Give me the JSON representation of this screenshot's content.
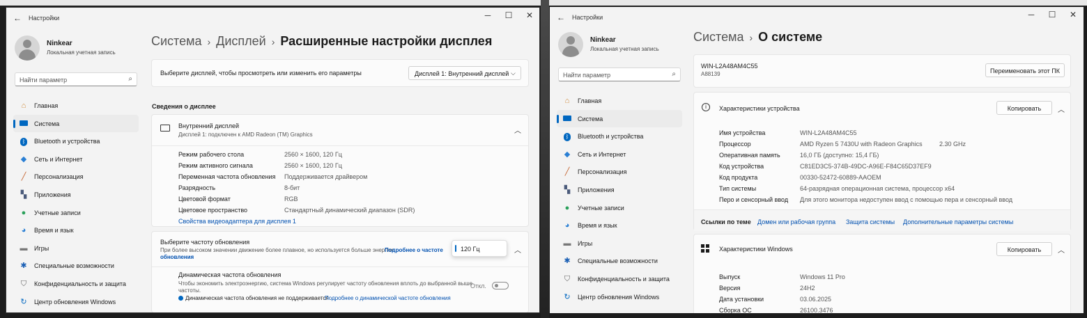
{
  "left": {
    "app_title": "Настройки",
    "profile": {
      "name": "Ninkear",
      "subtitle": "Локальная учетная запись"
    },
    "search_placeholder": "Найти параметр",
    "nav": [
      {
        "label": "Главная",
        "icon": "home-icon"
      },
      {
        "label": "Система",
        "icon": "monitor-icon"
      },
      {
        "label": "Bluetooth и устройства",
        "icon": "bluetooth-icon"
      },
      {
        "label": "Сеть и Интернет",
        "icon": "wifi-icon"
      },
      {
        "label": "Персонализация",
        "icon": "brush-icon"
      },
      {
        "label": "Приложения",
        "icon": "apps-icon"
      },
      {
        "label": "Учетные записи",
        "icon": "user-icon"
      },
      {
        "label": "Время и язык",
        "icon": "globe-icon"
      },
      {
        "label": "Игры",
        "icon": "gamepad-icon"
      },
      {
        "label": "Специальные возможности",
        "icon": "accessibility-icon"
      },
      {
        "label": "Конфиденциальность и защита",
        "icon": "shield-icon"
      },
      {
        "label": "Центр обновления Windows",
        "icon": "update-icon"
      }
    ],
    "breadcrumb": [
      "Система",
      "Дисплей"
    ],
    "page_title": "Расширенные настройки дисплея",
    "select_prompt": "Выберите дисплей, чтобы просмотреть или изменить его параметры",
    "display_select": "Дисплей 1: Внутренний дисплей",
    "section_title": "Сведения о дисплее",
    "display_name": "Внутренний дисплей",
    "display_sub": "Дисплей 1: подключен к AMD Radeon (TM) Graphics",
    "info": [
      {
        "k": "Режим рабочего стола",
        "v": "2560 × 1600, 120 Гц"
      },
      {
        "k": "Режим активного сигнала",
        "v": "2560 × 1600, 120 Гц"
      },
      {
        "k": "Переменная частота обновления",
        "v": "Поддерживается драйвером"
      },
      {
        "k": "Разрядность",
        "v": "8-бит"
      },
      {
        "k": "Цветовой формат",
        "v": "RGB"
      },
      {
        "k": "Цветовое пространство",
        "v": "Стандартный динамический диапазон (SDR)"
      }
    ],
    "adapter_link": "Свойства видеоадаптера для дисплея 1",
    "refresh_title": "Выберите частоту обновления",
    "refresh_desc": "При более высоком значении движение более плавное, но используется больше энергии",
    "refresh_more_a": "Подробнее о частоте",
    "refresh_more_b": "обновления",
    "refresh_value": "120 Гц",
    "dynamic_title": "Динамическая частота обновления",
    "dynamic_desc_a": "Чтобы экономить электроэнергию, система Windows регулирует частоту обновления вплоть до выбранной выше",
    "dynamic_desc_b": "частоты.",
    "dynamic_toggle": "Откл.",
    "dynamic_note": "Динамическая частота обновления не поддерживается",
    "dynamic_more": "Подробнее о динамической частоте обновления"
  },
  "right": {
    "app_title": "Настройки",
    "profile": {
      "name": "Ninkear",
      "subtitle": "Локальная учетная запись"
    },
    "search_placeholder": "Найти параметр",
    "breadcrumb": [
      "Система"
    ],
    "page_title": "О системе",
    "pc_name": "WIN-L2A48AM4C55",
    "pc_model": "A88139",
    "rename_button": "Переименовать этот ПК",
    "device_section": "Характеристики устройства",
    "copy_button": "Копировать",
    "device_specs": [
      {
        "k": "Имя устройства",
        "v": "WIN-L2A48AM4C55"
      },
      {
        "k": "Процессор",
        "v": "AMD Ryzen 5 7430U with Radeon Graphics",
        "extra": "2.30 GHz"
      },
      {
        "k": "Оперативная память",
        "v": "16,0 ГБ (доступно: 15,4 ГБ)"
      },
      {
        "k": "Код устройства",
        "v": "C81ED3C5-374B-49DC-A96E-F84C65D37EF9"
      },
      {
        "k": "Код продукта",
        "v": "00330-52472-60889-AAOEM"
      },
      {
        "k": "Тип системы",
        "v": "64-разрядная операционная система, процессор x64"
      },
      {
        "k": "Перо и сенсорный ввод",
        "v": "Для этого монитора недоступен ввод с помощью пера и сенсорный ввод"
      }
    ],
    "related_label": "Ссылки по теме",
    "related_links": [
      "Домен или рабочая группа",
      "Защита системы",
      "Дополнительные параметры системы"
    ],
    "windows_section": "Характеристики Windows",
    "windows_specs": [
      {
        "k": "Выпуск",
        "v": "Windows 11 Pro"
      },
      {
        "k": "Версия",
        "v": "24H2"
      },
      {
        "k": "Дата установки",
        "v": "03.06.2025"
      },
      {
        "k": "Сборка ОС",
        "v": "26100.3476"
      }
    ]
  },
  "colors": {
    "accent": "#0067c0",
    "link": "#0050b0"
  }
}
